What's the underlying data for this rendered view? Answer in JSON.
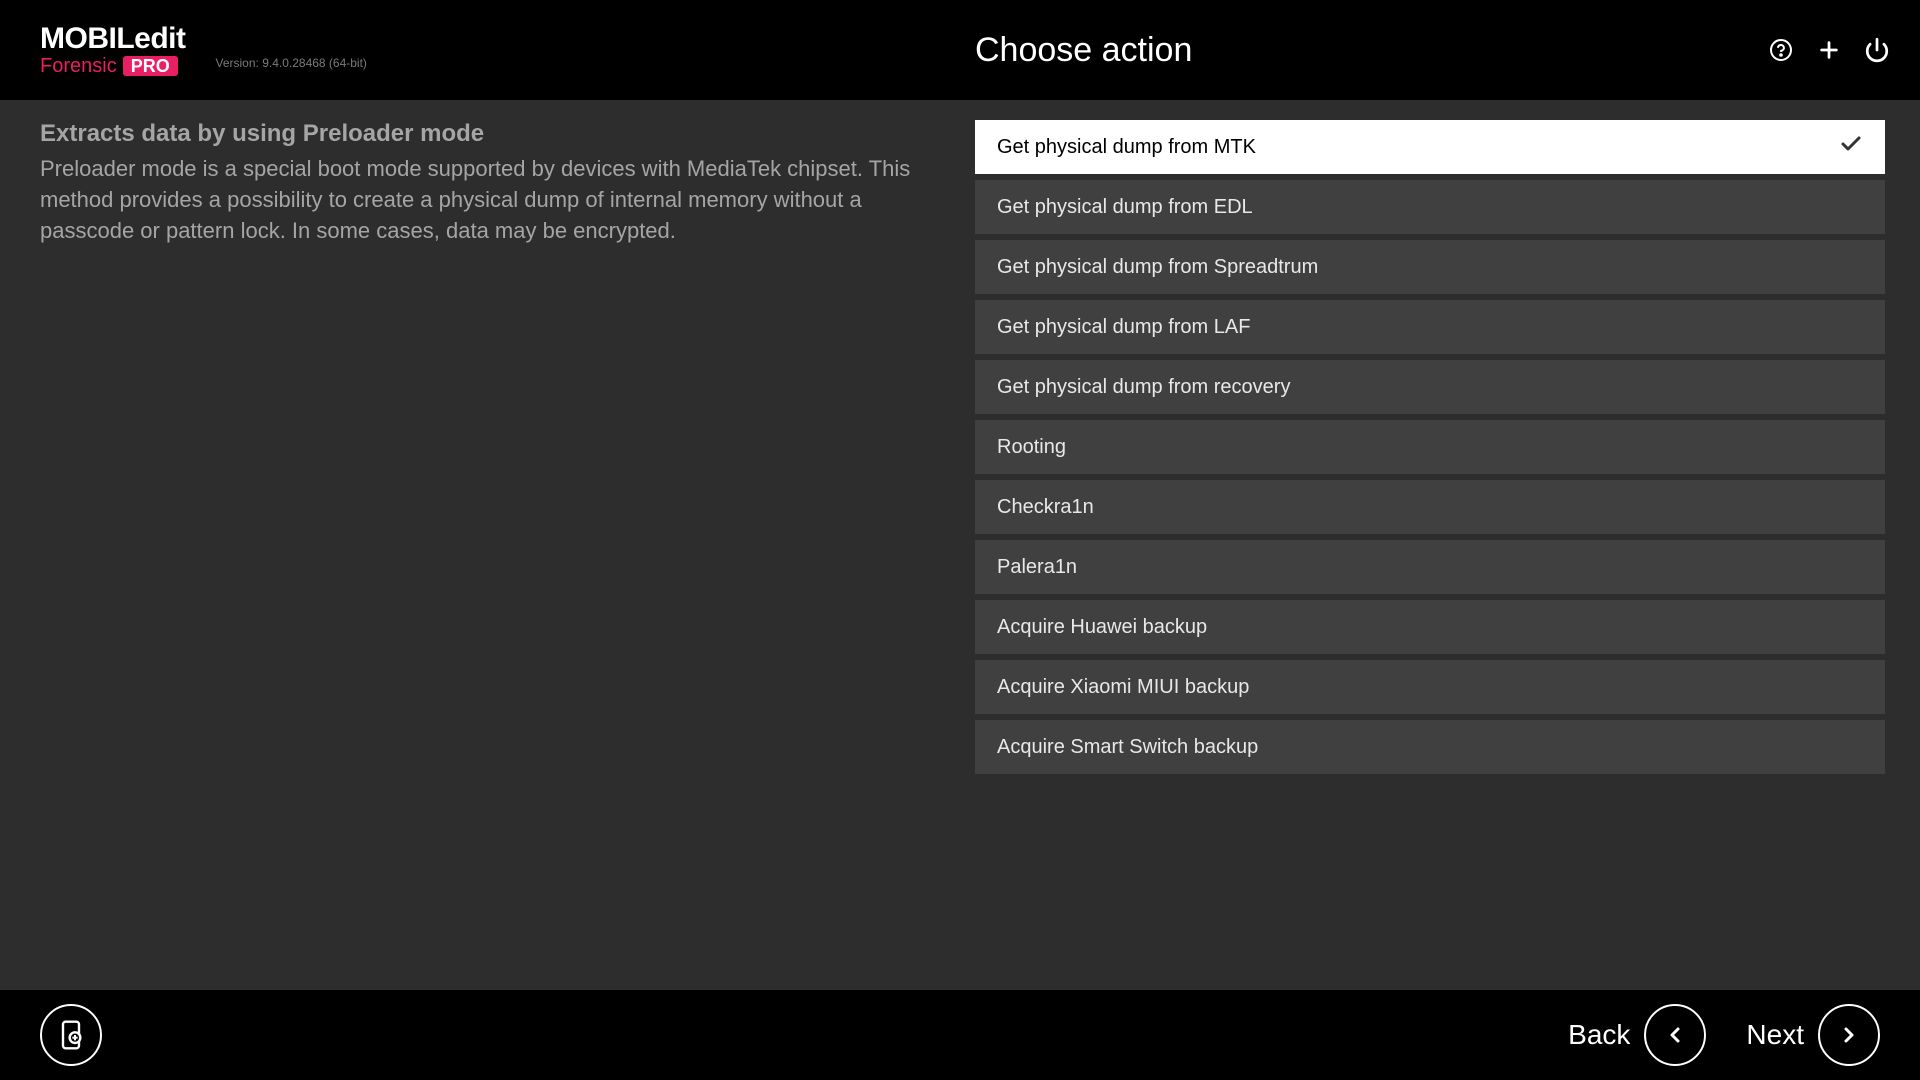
{
  "header": {
    "logo_main": "MOBILedit",
    "logo_forensic": "Forensic",
    "logo_pro": "PRO",
    "version": "Version: 9.4.0.28468 (64-bit)",
    "title": "Choose action"
  },
  "description": {
    "title": "Extracts data by using Preloader mode",
    "text": "Preloader mode is a special boot mode supported by devices with MediaTek chipset. This method provides a possibility to create a physical dump of internal memory without a passcode or pattern lock. In some cases, data may be encrypted."
  },
  "actions": [
    {
      "label": "Get physical dump from MTK",
      "selected": true
    },
    {
      "label": "Get physical dump from EDL",
      "selected": false
    },
    {
      "label": "Get physical dump from Spreadtrum",
      "selected": false
    },
    {
      "label": "Get physical dump from LAF",
      "selected": false
    },
    {
      "label": "Get physical dump from recovery",
      "selected": false
    },
    {
      "label": "Rooting",
      "selected": false
    },
    {
      "label": "Checkra1n",
      "selected": false
    },
    {
      "label": "Palera1n",
      "selected": false
    },
    {
      "label": "Acquire Huawei backup",
      "selected": false
    },
    {
      "label": "Acquire Xiaomi MIUI backup",
      "selected": false
    },
    {
      "label": "Acquire Smart Switch backup",
      "selected": false
    }
  ],
  "footer": {
    "back_label": "Back",
    "next_label": "Next"
  }
}
